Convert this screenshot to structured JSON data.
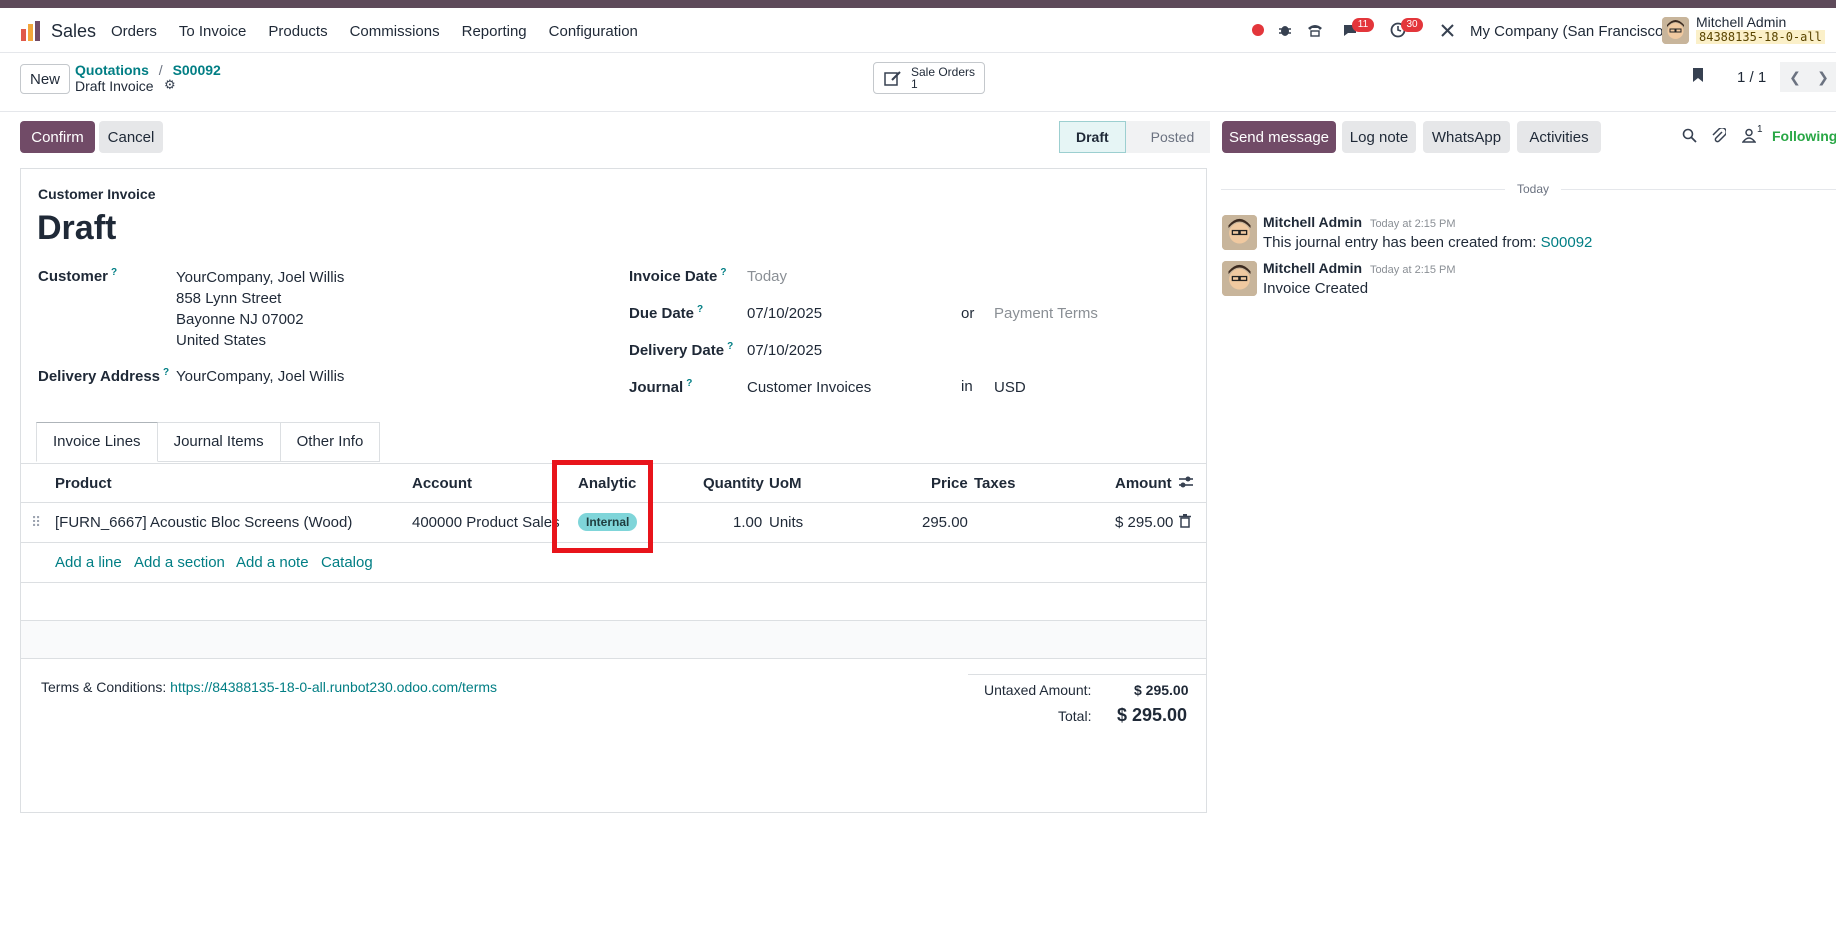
{
  "navbar": {
    "app_name": "Sales",
    "menu": [
      "Orders",
      "To Invoice",
      "Products",
      "Commissions",
      "Reporting",
      "Configuration"
    ],
    "messages_badge": "11",
    "activities_badge": "30",
    "company": "My Company (San Francisco)",
    "user_name": "Mitchell Admin",
    "db_name": "84388135-18-0-all"
  },
  "control": {
    "new_label": "New",
    "breadcrumb_parent": "Quotations",
    "breadcrumb_sep": "/",
    "breadcrumb_current": "S00092",
    "record_name": "Draft Invoice",
    "smart_button_label": "Sale Orders",
    "smart_button_count": "1",
    "pager": "1 / 1"
  },
  "actions": {
    "confirm_label": "Confirm",
    "cancel_label": "Cancel",
    "status_draft": "Draft",
    "status_posted": "Posted"
  },
  "invoice": {
    "type_label": "Customer Invoice",
    "state_title": "Draft",
    "customer_label": "Customer",
    "customer_lines": [
      "YourCompany, Joel Willis",
      "858 Lynn Street",
      "Bayonne NJ 07002",
      "United States"
    ],
    "delivery_label": "Delivery Address",
    "delivery_value": "YourCompany, Joel Willis",
    "invoice_date_label": "Invoice Date",
    "invoice_date_placeholder": "Today",
    "due_date_label": "Due Date",
    "due_date_value": "07/10/2025",
    "or_text": "or",
    "payment_terms_placeholder": "Payment Terms",
    "delivery_date_label": "Delivery Date",
    "delivery_date_value": "07/10/2025",
    "journal_label": "Journal",
    "journal_value": "Customer Invoices",
    "in_text": "in",
    "currency": "USD"
  },
  "tabs": [
    "Invoice Lines",
    "Journal Items",
    "Other Info"
  ],
  "lines": {
    "headers": {
      "product": "Product",
      "account": "Account",
      "analytic": "Analytic",
      "quantity": "Quantity",
      "uom": "UoM",
      "price": "Price",
      "taxes": "Taxes",
      "amount": "Amount"
    },
    "row": {
      "product": "[FURN_6667] Acoustic Bloc Screens (Wood)",
      "account": "400000 Product Sales",
      "analytic": "Internal",
      "quantity": "1.00",
      "uom": "Units",
      "price": "295.00",
      "amount": "$ 295.00"
    },
    "add_line": "Add a line",
    "add_section": "Add a section",
    "add_note": "Add a note",
    "catalog": "Catalog"
  },
  "footer": {
    "terms_label": "Terms & Conditions:",
    "terms_link": "https://84388135-18-0-all.runbot230.odoo.com/terms",
    "untaxed_label": "Untaxed Amount:",
    "untaxed_value": "$ 295.00",
    "total_label": "Total:",
    "total_value": "$ 295.00"
  },
  "chatter": {
    "send_message": "Send message",
    "log_note": "Log note",
    "whatsapp": "WhatsApp",
    "activities": "Activities",
    "followers_count": "1",
    "following": "Following",
    "date_separator": "Today",
    "messages": [
      {
        "author": "Mitchell Admin",
        "time": "Today at 2:15 PM",
        "body": "This journal entry has been created from:",
        "link": "S00092"
      },
      {
        "author": "Mitchell Admin",
        "time": "Today at 2:15 PM",
        "body": "Invoice Created"
      }
    ]
  },
  "colors": {
    "brand": "#714b67",
    "link": "#017e84",
    "highlight": "#e8141b",
    "analytic_tag": "#7fd5d9"
  }
}
